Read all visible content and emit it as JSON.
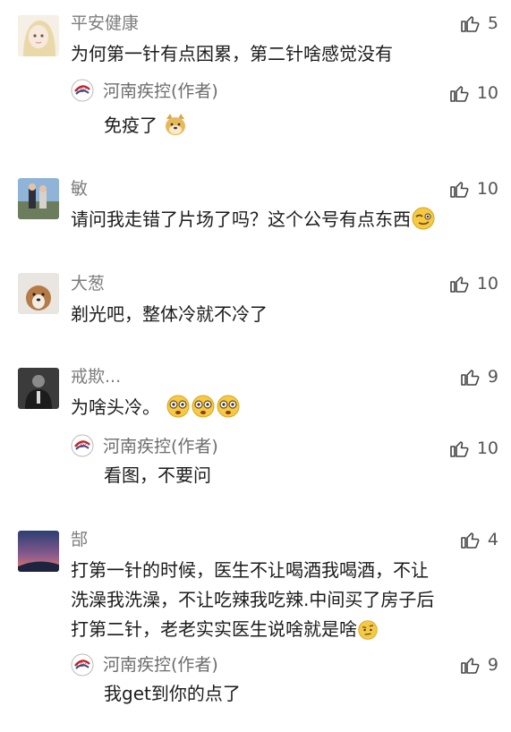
{
  "comments": [
    {
      "nickname": "平安健康",
      "likes": "5",
      "text": "为何第一针有点困累，第二针啥感觉没有",
      "reply": {
        "author": "河南疾控(作者)",
        "likes": "10",
        "text": "免疫了"
      }
    },
    {
      "nickname": "敏",
      "likes": "10",
      "text": "请问我走错了片场了吗？这个公号有点东西"
    },
    {
      "nickname": "大葱",
      "likes": "10",
      "text": "剃光吧，整体冷就不冷了"
    },
    {
      "nickname": "戒欺...",
      "likes": "9",
      "text": "为啥头冷。",
      "reply": {
        "author": "河南疾控(作者)",
        "likes": "10",
        "text": "看图，不要问"
      }
    },
    {
      "nickname": "郜",
      "likes": "4",
      "lines": [
        "打第一针的时候，医生不让喝酒我喝酒，不让",
        "洗澡我洗澡，不让吃辣我吃辣.中间买了房子后",
        "打第二针，老老实实医生说啥就是啥"
      ],
      "reply": {
        "author": "河南疾控(作者)",
        "likes": "9",
        "text": "我get到你的点了"
      }
    }
  ],
  "icons": {
    "like": "thumbs-up-icon",
    "author_logo": "cdc-logo-icon"
  }
}
